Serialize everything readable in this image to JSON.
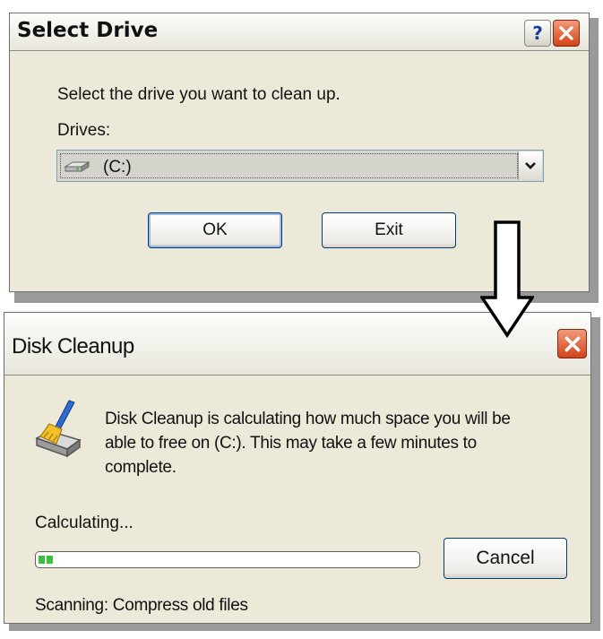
{
  "select_drive": {
    "title": "Select Drive",
    "prompt": "Select the drive you want to clean up.",
    "drives_label": "Drives:",
    "selected_drive": "(C:)",
    "ok_label": "OK",
    "exit_label": "Exit"
  },
  "disk_cleanup": {
    "title": "Disk Cleanup",
    "message_line1": "Disk Cleanup is calculating how much space you will be",
    "message_line2": "able to free on  (C:). This may take a few minutes to",
    "message_line3": "complete.",
    "status": "Calculating...",
    "progress_fraction": 0.04,
    "cancel_label": "Cancel",
    "scanning_text": "Scanning:  Compress old files"
  },
  "icons": {
    "help": "help-icon",
    "close": "close-icon",
    "drive": "hard-drive-icon",
    "dropdown": "chevron-down-icon",
    "cleanup": "disk-cleanup-broom-icon",
    "arrow": "down-arrow-icon"
  },
  "colors": {
    "dialog_bg": "#ece9d8",
    "close_red": "#d3431a",
    "progress_green": "#37c23b",
    "button_border": "#003c74"
  },
  "titlebar_help_glyph": "?"
}
